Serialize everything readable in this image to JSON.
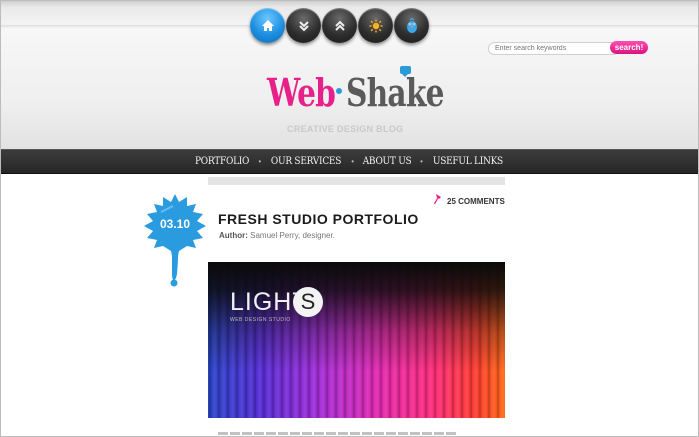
{
  "top_nav": {
    "buttons": [
      {
        "icon": "home-icon",
        "style": "blue"
      },
      {
        "icon": "chevron-double-down-icon",
        "style": "dark"
      },
      {
        "icon": "chevron-double-up-icon",
        "style": "dark"
      },
      {
        "icon": "sun-icon",
        "style": "dark"
      },
      {
        "icon": "bird-icon",
        "style": "dark"
      }
    ]
  },
  "search": {
    "placeholder": "Enter search keywords",
    "button_label": "search!"
  },
  "logo": {
    "part1": "Web",
    "part2": "Shake",
    "tagline": "CREATIVE DESIGN BLOG"
  },
  "main_nav": {
    "items": [
      {
        "label": "PORTFOLIO"
      },
      {
        "label": "OUR SERVICES"
      },
      {
        "label": "ABOUT US"
      },
      {
        "label": "USEFUL LINKS"
      }
    ],
    "separator": "•"
  },
  "post": {
    "date": "03.10",
    "comments": "25 COMMENTS",
    "title": "FRESH STUDIO PORTFOLIO",
    "author_label": "Author:",
    "author": "Samuel Perry, designer.",
    "image": {
      "brand_word": "LIGHT",
      "brand_letter": "S",
      "brand_sub": "WEB DESIGN STUDIO"
    }
  },
  "colors": {
    "accent_pink": "#e8208a",
    "accent_blue": "#2a9ad8",
    "nav_bar": "#2f2f2f"
  }
}
